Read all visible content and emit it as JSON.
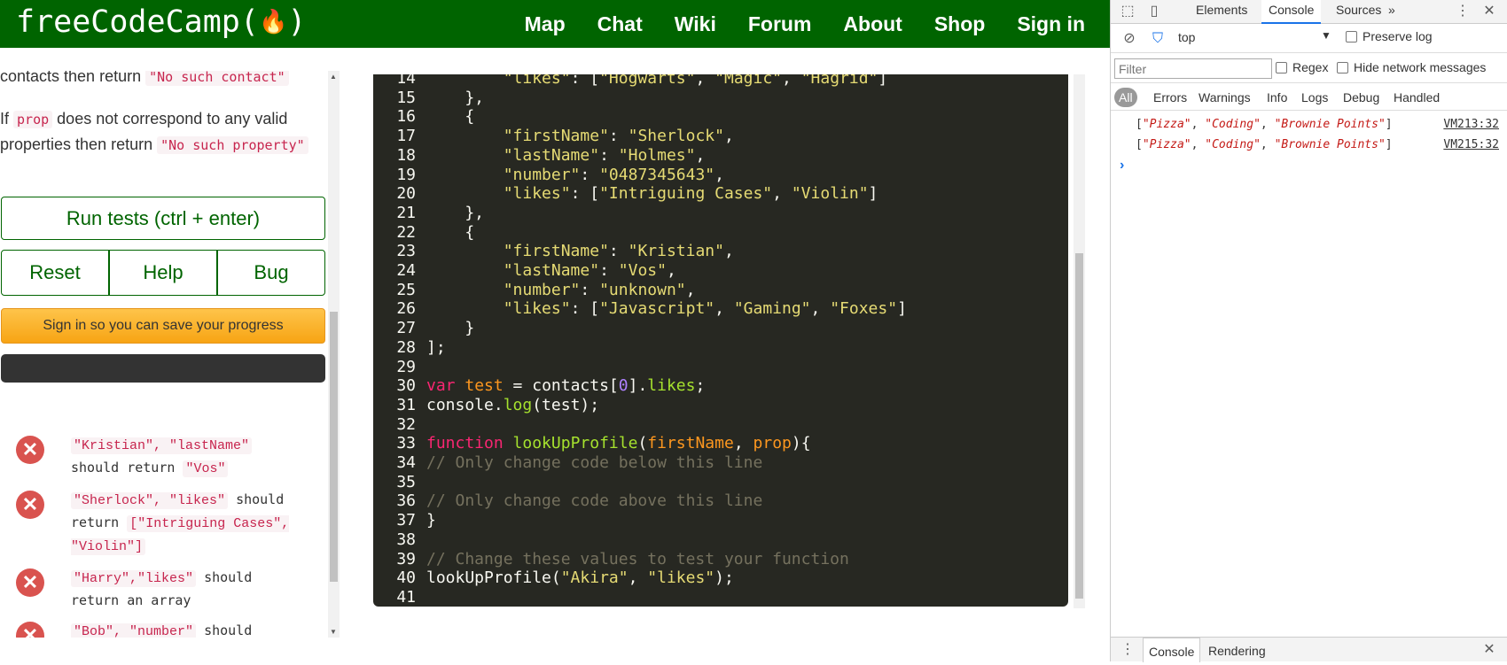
{
  "fcc": {
    "logo_text": "freeCodeCamp(",
    "logo_close": ")",
    "logo_flame": "🔥",
    "nav": [
      "Map",
      "Chat",
      "Wiki",
      "Forum",
      "About",
      "Shop",
      "Sign in"
    ]
  },
  "instructions": {
    "cutoff_text": "contacts then return",
    "cutoff_code": "\"No such contact\"",
    "line_before": "If",
    "prop_code": "prop",
    "line_after": "does not correspond to any valid properties then return",
    "no_such_property": "\"No such property\""
  },
  "buttons": {
    "run": "Run tests (ctrl + enter)",
    "reset": "Reset",
    "help": "Help",
    "bug": "Bug",
    "signin": "Sign in so you can save your progress"
  },
  "tests": [
    {
      "icon": "✕",
      "code": "\"Kristian\", \"lastName\"",
      "text": "should return",
      "code2": "\"Vos\""
    },
    {
      "icon": "✕",
      "code": "\"Sherlock\", \"likes\"",
      "text": "should return",
      "code2": "[\"Intriguing Cases\", \"Violin\"]"
    },
    {
      "icon": "✕",
      "code": "\"Harry\",\"likes\"",
      "text": "should return an array",
      "code2": ""
    },
    {
      "icon": "✕",
      "code": "\"Bob\", \"number\"",
      "text": "should",
      "code2": ""
    }
  ],
  "editor": {
    "lines": [
      {
        "n": "14",
        "tokens": [
          [
            "",
            "        "
          ],
          [
            "st",
            "\"likes\""
          ],
          [
            "",
            ": ["
          ],
          [
            "st",
            "\"Hogwarts\""
          ],
          [
            "",
            ", "
          ],
          [
            "st",
            "\"Magic\""
          ],
          [
            "",
            ", "
          ],
          [
            "st",
            "\"Hagrid\""
          ],
          [
            "",
            "]"
          ]
        ]
      },
      {
        "n": "15",
        "tokens": [
          [
            "",
            "    },"
          ]
        ]
      },
      {
        "n": "16",
        "tokens": [
          [
            "",
            "    {"
          ]
        ]
      },
      {
        "n": "17",
        "tokens": [
          [
            "",
            "        "
          ],
          [
            "st",
            "\"firstName\""
          ],
          [
            "",
            ": "
          ],
          [
            "st",
            "\"Sherlock\""
          ],
          [
            "",
            ","
          ]
        ]
      },
      {
        "n": "18",
        "tokens": [
          [
            "",
            "        "
          ],
          [
            "st",
            "\"lastName\""
          ],
          [
            "",
            ": "
          ],
          [
            "st",
            "\"Holmes\""
          ],
          [
            "",
            ","
          ]
        ]
      },
      {
        "n": "19",
        "tokens": [
          [
            "",
            "        "
          ],
          [
            "st",
            "\"number\""
          ],
          [
            "",
            ": "
          ],
          [
            "st",
            "\"0487345643\""
          ],
          [
            "",
            ","
          ]
        ]
      },
      {
        "n": "20",
        "tokens": [
          [
            "",
            "        "
          ],
          [
            "st",
            "\"likes\""
          ],
          [
            "",
            ": ["
          ],
          [
            "st",
            "\"Intriguing Cases\""
          ],
          [
            "",
            ", "
          ],
          [
            "st",
            "\"Violin\""
          ],
          [
            "",
            "]"
          ]
        ]
      },
      {
        "n": "21",
        "tokens": [
          [
            "",
            "    },"
          ]
        ]
      },
      {
        "n": "22",
        "tokens": [
          [
            "",
            "    {"
          ]
        ]
      },
      {
        "n": "23",
        "tokens": [
          [
            "",
            "        "
          ],
          [
            "st",
            "\"firstName\""
          ],
          [
            "",
            ": "
          ],
          [
            "st",
            "\"Kristian\""
          ],
          [
            "",
            ","
          ]
        ]
      },
      {
        "n": "24",
        "tokens": [
          [
            "",
            "        "
          ],
          [
            "st",
            "\"lastName\""
          ],
          [
            "",
            ": "
          ],
          [
            "st",
            "\"Vos\""
          ],
          [
            "",
            ","
          ]
        ]
      },
      {
        "n": "25",
        "tokens": [
          [
            "",
            "        "
          ],
          [
            "st",
            "\"number\""
          ],
          [
            "",
            ": "
          ],
          [
            "st",
            "\"unknown\""
          ],
          [
            "",
            ","
          ]
        ]
      },
      {
        "n": "26",
        "tokens": [
          [
            "",
            "        "
          ],
          [
            "st",
            "\"likes\""
          ],
          [
            "",
            ": ["
          ],
          [
            "st",
            "\"Javascript\""
          ],
          [
            "",
            ", "
          ],
          [
            "st",
            "\"Gaming\""
          ],
          [
            "",
            ", "
          ],
          [
            "st",
            "\"Foxes\""
          ],
          [
            "",
            "]"
          ]
        ]
      },
      {
        "n": "27",
        "tokens": [
          [
            "",
            "    }"
          ]
        ]
      },
      {
        "n": "28",
        "tokens": [
          [
            "",
            "];"
          ]
        ]
      },
      {
        "n": "29",
        "tokens": []
      },
      {
        "n": "30",
        "tokens": [
          [
            "kw",
            "var"
          ],
          [
            "",
            " "
          ],
          [
            "pa",
            "test"
          ],
          [
            "",
            " = contacts["
          ],
          [
            "nu",
            "0"
          ],
          [
            "",
            "]."
          ],
          [
            "fn",
            "likes"
          ],
          [
            "",
            ";"
          ]
        ]
      },
      {
        "n": "31",
        "tokens": [
          [
            "",
            "console."
          ],
          [
            "fn",
            "log"
          ],
          [
            "",
            "(test);"
          ]
        ]
      },
      {
        "n": "32",
        "tokens": []
      },
      {
        "n": "33",
        "tokens": [
          [
            "kw",
            "function"
          ],
          [
            "",
            " "
          ],
          [
            "fn",
            "lookUpProfile"
          ],
          [
            "",
            "("
          ],
          [
            "pa",
            "firstName"
          ],
          [
            "",
            ", "
          ],
          [
            "pa",
            "prop"
          ],
          [
            "",
            "){"
          ]
        ]
      },
      {
        "n": "34",
        "tokens": [
          [
            "cm",
            "// Only change code below this line"
          ]
        ]
      },
      {
        "n": "35",
        "tokens": []
      },
      {
        "n": "36",
        "tokens": [
          [
            "cm",
            "// Only change code above this line"
          ]
        ]
      },
      {
        "n": "37",
        "tokens": [
          [
            "",
            "}"
          ]
        ]
      },
      {
        "n": "38",
        "tokens": []
      },
      {
        "n": "39",
        "tokens": [
          [
            "cm",
            "// Change these values to test your function"
          ]
        ]
      },
      {
        "n": "40",
        "tokens": [
          [
            "",
            "lookUpProfile("
          ],
          [
            "st",
            "\"Akira\""
          ],
          [
            "",
            ", "
          ],
          [
            "st",
            "\"likes\""
          ],
          [
            "",
            ");"
          ]
        ]
      },
      {
        "n": "41",
        "tokens": []
      }
    ]
  },
  "devtools": {
    "tabs": [
      "Elements",
      "Console",
      "Sources"
    ],
    "more_tabs": "»",
    "close": "✕",
    "menu": "⋮",
    "context": "top",
    "preserve_log": "Preserve log",
    "filter_placeholder": "Filter",
    "regex": "Regex",
    "hide_network": "Hide network messages",
    "levels": [
      "All",
      "Errors",
      "Warnings",
      "Info",
      "Logs",
      "Debug",
      "Handled"
    ],
    "messages": [
      {
        "values": [
          "Pizza",
          "Coding",
          "Brownie Points"
        ],
        "source": "VM213:32"
      },
      {
        "values": [
          "Pizza",
          "Coding",
          "Brownie Points"
        ],
        "source": "VM215:32"
      }
    ],
    "prompt": "›",
    "drawer_tabs": [
      "Console",
      "Rendering"
    ]
  }
}
